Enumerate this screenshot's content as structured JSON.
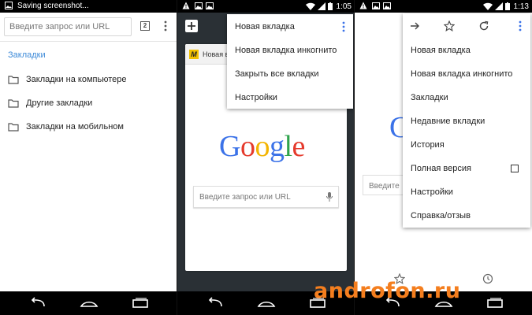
{
  "panel1": {
    "status": {
      "text": "Saving screenshot..."
    },
    "omnibox": {
      "placeholder": "Введите запрос или URL"
    },
    "tab_count": "2",
    "bookmarks": {
      "title": "Закладки",
      "items": [
        {
          "label": "Закладки на компьютере",
          "icon": "folder-icon"
        },
        {
          "label": "Другие закладки",
          "icon": "folder-icon"
        },
        {
          "label": "Закладки на мобильном",
          "icon": "folder-icon"
        }
      ]
    }
  },
  "panel2": {
    "status": {
      "time": "1:05"
    },
    "tab": {
      "title": "Новая вкладка",
      "favicon_letter": "M"
    },
    "google": {
      "letters": [
        "G",
        "o",
        "o",
        "g",
        "l",
        "e"
      ]
    },
    "search": {
      "placeholder": "Введите запрос или URL"
    },
    "menu": {
      "items": [
        "Новая вкладка",
        "Новая вкладка инкогнито",
        "Закрыть все вкладки",
        "Настройки"
      ]
    }
  },
  "panel3": {
    "status": {
      "time": "1:13"
    },
    "search_fragment": "Введите",
    "google_fragment": "G",
    "menu": {
      "toolbar_icons": [
        "arrow-forward-icon",
        "star-icon",
        "refresh-icon",
        "kebab-icon"
      ],
      "items": [
        "Новая вкладка",
        "Новая вкладка инкогнито",
        "Закладки",
        "Недавние вкладки",
        "История",
        "Полная версия",
        "Настройки",
        "Справка/отзыв"
      ],
      "desktop_version_checked": false
    }
  },
  "watermark": "androfon.ru",
  "colors": {
    "accent_blue": "#3d8ad8",
    "watermark_orange": "#f47e1e",
    "google_blue": "#3b72e8",
    "google_red": "#e53a2c",
    "google_yellow": "#f3b400",
    "google_green": "#2fa34c"
  }
}
